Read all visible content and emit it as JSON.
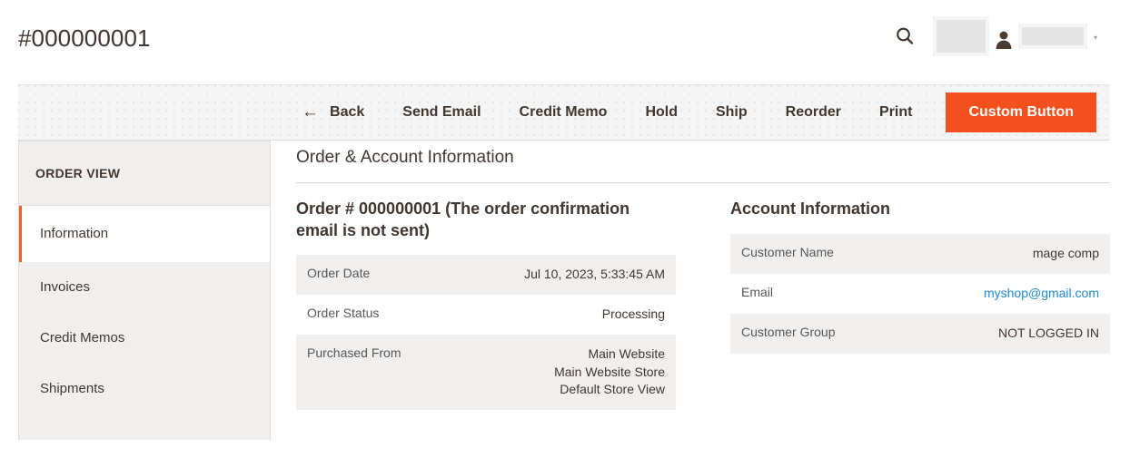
{
  "header": {
    "title": "#000000001",
    "search_icon": "search-icon",
    "user_icon": "user-icon",
    "caret": "▾"
  },
  "toolbar": {
    "buttons": [
      {
        "label": "Back",
        "icon": "arrow-left-icon",
        "arrow": "←",
        "primary": false
      },
      {
        "label": "Send Email",
        "primary": false
      },
      {
        "label": "Credit Memo",
        "primary": false
      },
      {
        "label": "Hold",
        "primary": false
      },
      {
        "label": "Ship",
        "primary": false
      },
      {
        "label": "Reorder",
        "primary": false
      },
      {
        "label": "Print",
        "primary": false
      },
      {
        "label": "Custom Button",
        "primary": true
      }
    ],
    "primary_color": "#f4501e"
  },
  "sidebar": {
    "title": "ORDER VIEW",
    "active_accent": "#ee5e28",
    "items": [
      {
        "label": "Information",
        "active": true
      },
      {
        "label": "Invoices",
        "active": false
      },
      {
        "label": "Credit Memos",
        "active": false
      },
      {
        "label": "Shipments",
        "active": false
      }
    ]
  },
  "main": {
    "section_title": "Order & Account Information",
    "order": {
      "heading": "Order # 000000001 (The order confirmation email is not sent)",
      "rows": [
        {
          "label": "Order Date",
          "value": "Jul 10, 2023, 5:33:45 AM"
        },
        {
          "label": "Order Status",
          "value": "Processing"
        },
        {
          "label": "Purchased From",
          "value": "Main Website\nMain Website Store\nDefault Store View"
        }
      ]
    },
    "account": {
      "heading": "Account Information",
      "rows": [
        {
          "label": "Customer Name",
          "value": "mage comp",
          "link": false
        },
        {
          "label": "Email",
          "value": "myshop@gmail.com",
          "link": true
        },
        {
          "label": "Customer Group",
          "value": "NOT LOGGED IN",
          "link": false
        }
      ],
      "link_color": "#1f8ad2"
    }
  }
}
